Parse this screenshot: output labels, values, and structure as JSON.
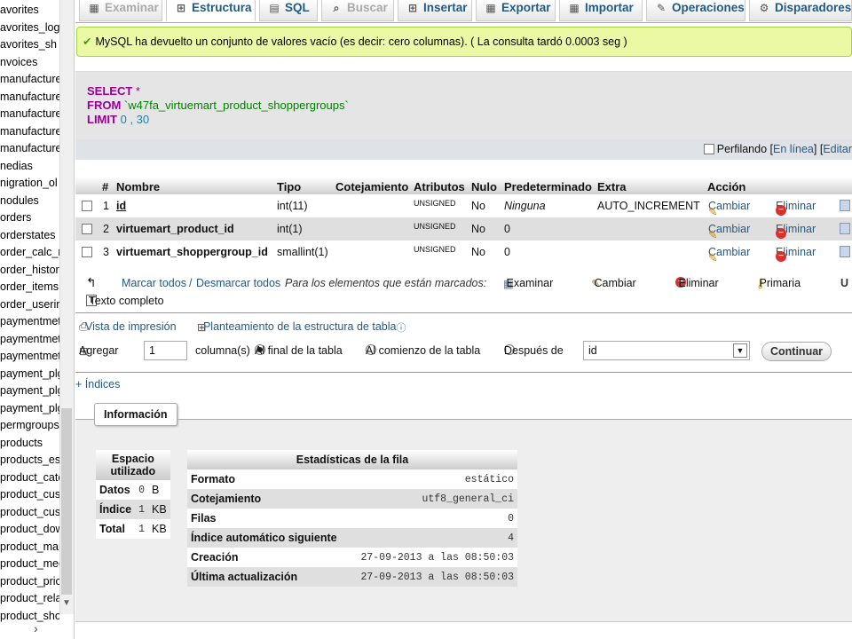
{
  "sidebar": {
    "items": [
      "avorites",
      "avorites_log",
      "avorites_sh",
      "nvoices",
      "manufacture",
      "manufacture",
      "manufacture",
      "manufacture",
      "manufacture",
      "nedias",
      "nigration_ol",
      "nodules",
      "orders",
      "orderstates",
      "order_calc_r",
      "order_histori",
      "order_items",
      "order_userin",
      "paymentmetl",
      "paymentmetl",
      "paymentmetl",
      "payment_plg",
      "payment_plg",
      "payment_plg",
      "permgroups",
      "products",
      "products_es_",
      "product_cate",
      "product_cust",
      "product_cust",
      "product_dow",
      "product_mar",
      "product_mec",
      "product_pric",
      "product_rela",
      "product_sho"
    ]
  },
  "tabs": [
    {
      "label": "Examinar",
      "icon": "table-icon",
      "glyph": "▦"
    },
    {
      "label": "Estructura",
      "icon": "structure-icon",
      "glyph": "⊞"
    },
    {
      "label": "SQL",
      "icon": "sql-icon",
      "glyph": "▤"
    },
    {
      "label": "Buscar",
      "icon": "search-icon",
      "glyph": "⌕"
    },
    {
      "label": "Insertar",
      "icon": "insert-icon",
      "glyph": "⊞"
    },
    {
      "label": "Exportar",
      "icon": "export-icon",
      "glyph": "▦"
    },
    {
      "label": "Importar",
      "icon": "import-icon",
      "glyph": "▦"
    },
    {
      "label": "Operaciones",
      "icon": "wrench-icon",
      "glyph": "✎"
    },
    {
      "label": "Disparadores",
      "icon": "triggers-icon",
      "glyph": "⚙"
    }
  ],
  "message": {
    "text": "MySQL ha devuelto un conjunto de valores vacío (es decir: cero columnas). ( La consulta tardó 0.0003 seg )"
  },
  "sql": {
    "select": "SELECT",
    "star": "*",
    "from": "FROM",
    "table": "`w47fa_virtuemart_product_shoppergroups`",
    "limit": "LIMIT",
    "limit_start": "0",
    "comma": ",",
    "limit_count": "30"
  },
  "profiling": {
    "label": "Perfilando",
    "open": "[",
    "inline_link": "En línea",
    "close": "]",
    "sep": "[",
    "edit_link": "Editar"
  },
  "structure": {
    "headers": {
      "num": "#",
      "name": "Nombre",
      "type": "Tipo",
      "collation": "Cotejamiento",
      "attributes": "Atributos",
      "null": "Nulo",
      "default": "Predeterminado",
      "extra": "Extra",
      "action": "Acción"
    },
    "rows": [
      {
        "num": "1",
        "name": "id",
        "type": "int(11)",
        "collation": "",
        "attributes": "UNSIGNED",
        "null": "No",
        "default": "Ninguna",
        "extra": "AUTO_INCREMENT"
      },
      {
        "num": "2",
        "name": "virtuemart_product_id",
        "type": "int(1)",
        "collation": "",
        "attributes": "UNSIGNED",
        "null": "No",
        "default": "0",
        "extra": ""
      },
      {
        "num": "3",
        "name": "virtuemart_shoppergroup_id",
        "type": "smallint(1)",
        "collation": "",
        "attributes": "UNSIGNED",
        "null": "No",
        "default": "0",
        "extra": ""
      }
    ],
    "change_label": "Cambiar",
    "delete_label": "Eliminar"
  },
  "bulk": {
    "check_all": "Marcar todos",
    "slash": "/",
    "uncheck_all": "Desmarcar todos",
    "with_selected": "Para los elementos que están marcados:",
    "browse": "Examinar",
    "change": "Cambiar",
    "delete": "Eliminar",
    "primary": "Primaria",
    "fulltext": "Texto completo"
  },
  "tools": {
    "print_view": "Vista de impresión",
    "propose": "Planteamiento de la estructura de tabla",
    "add_label": "Agregar",
    "add_count": "1",
    "columns": "columna(s)",
    "at_end": "Al final de la tabla",
    "at_start": "Al comienzo de la tabla",
    "after": "Después de",
    "after_field": "id",
    "continue": "Continuar"
  },
  "indices_link": "+ Índices",
  "info": {
    "legend": "Información",
    "space": {
      "header": "Espacio utilizado",
      "rows": [
        {
          "label": "Datos",
          "value": "0",
          "unit": "B"
        },
        {
          "label": "Índice",
          "value": "1",
          "unit": "KB"
        },
        {
          "label": "Total",
          "value": "1",
          "unit": "KB"
        }
      ]
    },
    "stats": {
      "header": "Estadísticas de la fila",
      "rows": [
        {
          "label": "Formato",
          "value": "estático"
        },
        {
          "label": "Cotejamiento",
          "value": "utf8_general_ci"
        },
        {
          "label": "Filas",
          "value": "0"
        },
        {
          "label": "Índice automático siguiente",
          "value": "4"
        },
        {
          "label": "Creación",
          "value": "27-09-2013 a las 08:50:03"
        },
        {
          "label": "Última actualización",
          "value": "27-09-2013 a las 08:50:03"
        }
      ]
    }
  },
  "colors": {
    "link": "#235a81",
    "success_bg": "#ebf8a4",
    "keyword": "#990099"
  }
}
